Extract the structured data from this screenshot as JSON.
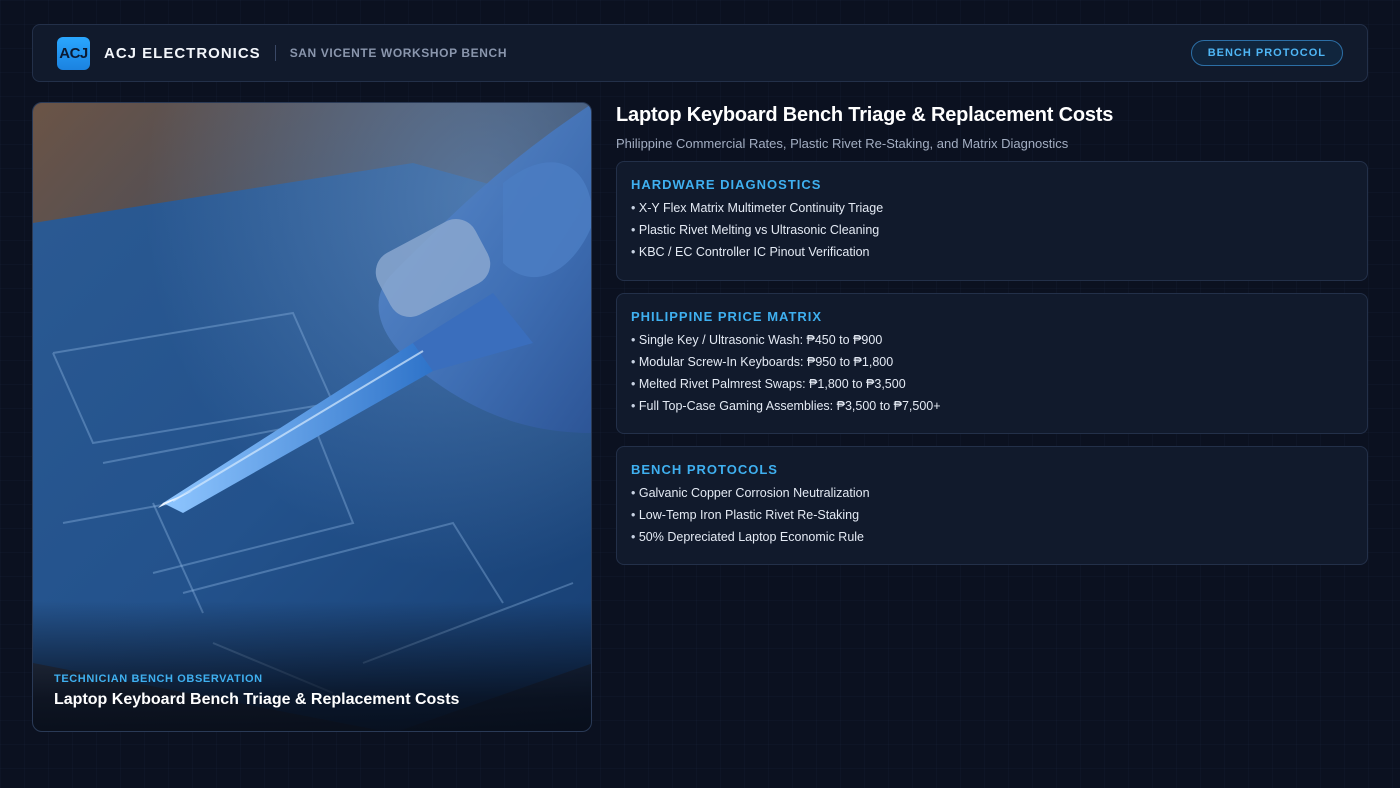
{
  "header": {
    "logo_text": "ACJ",
    "brand_name": "ACJ ELECTRONICS",
    "brand_sub": "SAN VICENTE WORKSHOP BENCH",
    "protocol_label": "BENCH PROTOCOL"
  },
  "photo": {
    "kicker": "TECHNICIAN BENCH OBSERVATION",
    "caption": "Laptop Keyboard Bench Triage & Replacement Costs"
  },
  "main": {
    "title": "Laptop Keyboard Bench Triage & Replacement Costs",
    "subtitle": "Philippine Commercial Rates, Plastic Rivet Re-Staking, and Matrix Diagnostics"
  },
  "panels": [
    {
      "title": "HARDWARE DIAGNOSTICS",
      "items": [
        "X-Y Flex Matrix Multimeter Continuity Triage",
        "Plastic Rivet Melting vs Ultrasonic Cleaning",
        "KBC / EC Controller IC Pinout Verification"
      ]
    },
    {
      "title": "PHILIPPINE PRICE MATRIX",
      "items": [
        "Single Key / Ultrasonic Wash: ₱450 to ₱900",
        "Modular Screw-In Keyboards: ₱950 to ₱1,800",
        "Melted Rivet Palmrest Swaps: ₱1,800 to ₱3,500",
        "Full Top-Case Gaming Assemblies: ₱3,500 to ₱7,500+"
      ]
    },
    {
      "title": "BENCH PROTOCOLS",
      "items": [
        "Galvanic Copper Corrosion Neutralization",
        "Low-Temp Iron Plastic Rivet Re-Staking",
        "50% Depreciated Laptop Economic Rule"
      ]
    }
  ],
  "colors": {
    "background": "#0b1120",
    "panel": "#111a2c",
    "accent": "#3fb0f0",
    "logo": "#2aa7ff"
  }
}
